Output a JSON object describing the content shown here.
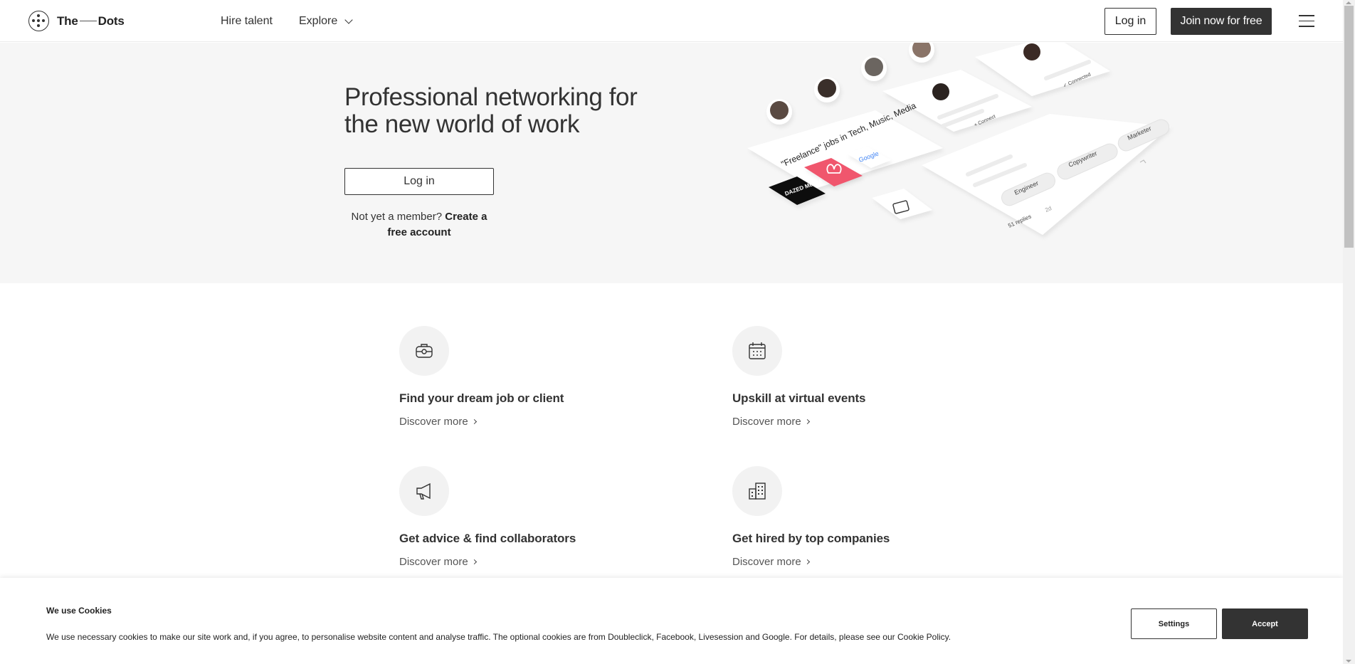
{
  "header": {
    "logo_left": "The",
    "logo_right": "Dots",
    "nav": {
      "hire": "Hire talent",
      "explore": "Explore"
    },
    "login": "Log in",
    "join": "Join now for free"
  },
  "hero": {
    "title": "Professional networking for the new world of work",
    "login": "Log in",
    "member_prefix": "Not yet a member?",
    "member_link": "Create a free account",
    "illustration": {
      "cards": {
        "freelance": "\"Freelance\" jobs in Tech, Music, Media",
        "connect": "+ Connect",
        "connected": "✓ Connected",
        "replies": "51 replies",
        "age": "2d",
        "tags": [
          "Engineer",
          "Copywriter",
          "Marketer"
        ],
        "google": "Google",
        "dazed": "DAZED MEDIA"
      }
    }
  },
  "features": [
    {
      "title": "Find your dream job or client",
      "link": "Discover more",
      "icon": "briefcase-icon"
    },
    {
      "title": "Upskill at virtual events",
      "link": "Discover more",
      "icon": "calendar-icon"
    },
    {
      "title": "Get advice & find collaborators",
      "link": "Discover more",
      "icon": "megaphone-icon"
    },
    {
      "title": "Get hired by top companies",
      "link": "Discover more",
      "icon": "building-icon"
    }
  ],
  "cookie": {
    "title": "We use Cookies",
    "text": "We use necessary cookies to make our site work and, if you agree, to personalise website content and analyse traffic. The optional cookies are from Doubleclick, Facebook, Livesession and Google. For details, please see our Cookie Policy.",
    "settings": "Settings",
    "accept": "Accept"
  },
  "colors": {
    "dark": "#333333",
    "hero_bg": "#f6f6f6",
    "airbnb": "#ff5a6e"
  }
}
